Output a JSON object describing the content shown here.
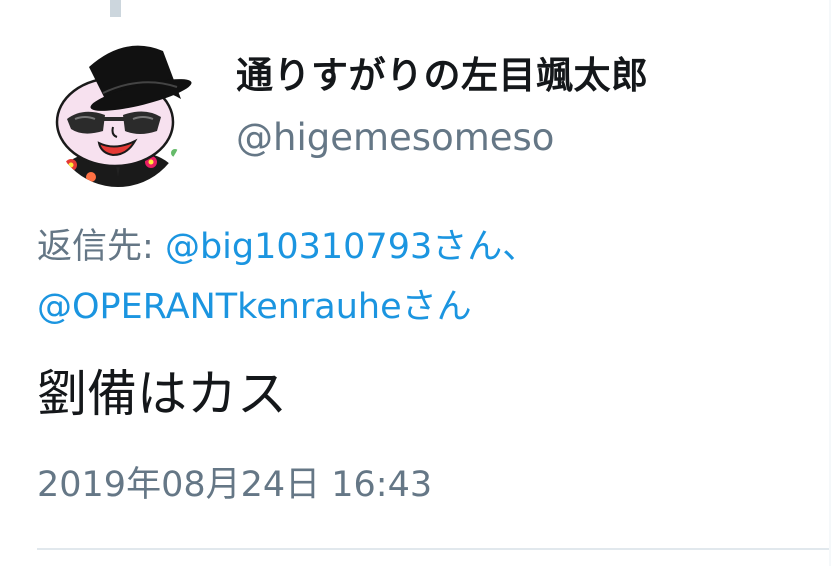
{
  "tweet": {
    "author": {
      "display_name": "通りすがりの左目颯太郎",
      "handle": "@higemesomeso",
      "avatar_icon": "top-hat-sunglasses-character-avatar"
    },
    "reply_to": {
      "prefix": "返信先:",
      "mentions": [
        "@big10310793さん、",
        "@OPERANTkenrauheさん"
      ]
    },
    "text": "劉備はカス",
    "timestamp": "2019年08月24日 16:43"
  },
  "colors": {
    "text_primary": "#14171a",
    "text_secondary": "#657786",
    "link": "#1b95e0",
    "divider": "#e1e8ed"
  }
}
